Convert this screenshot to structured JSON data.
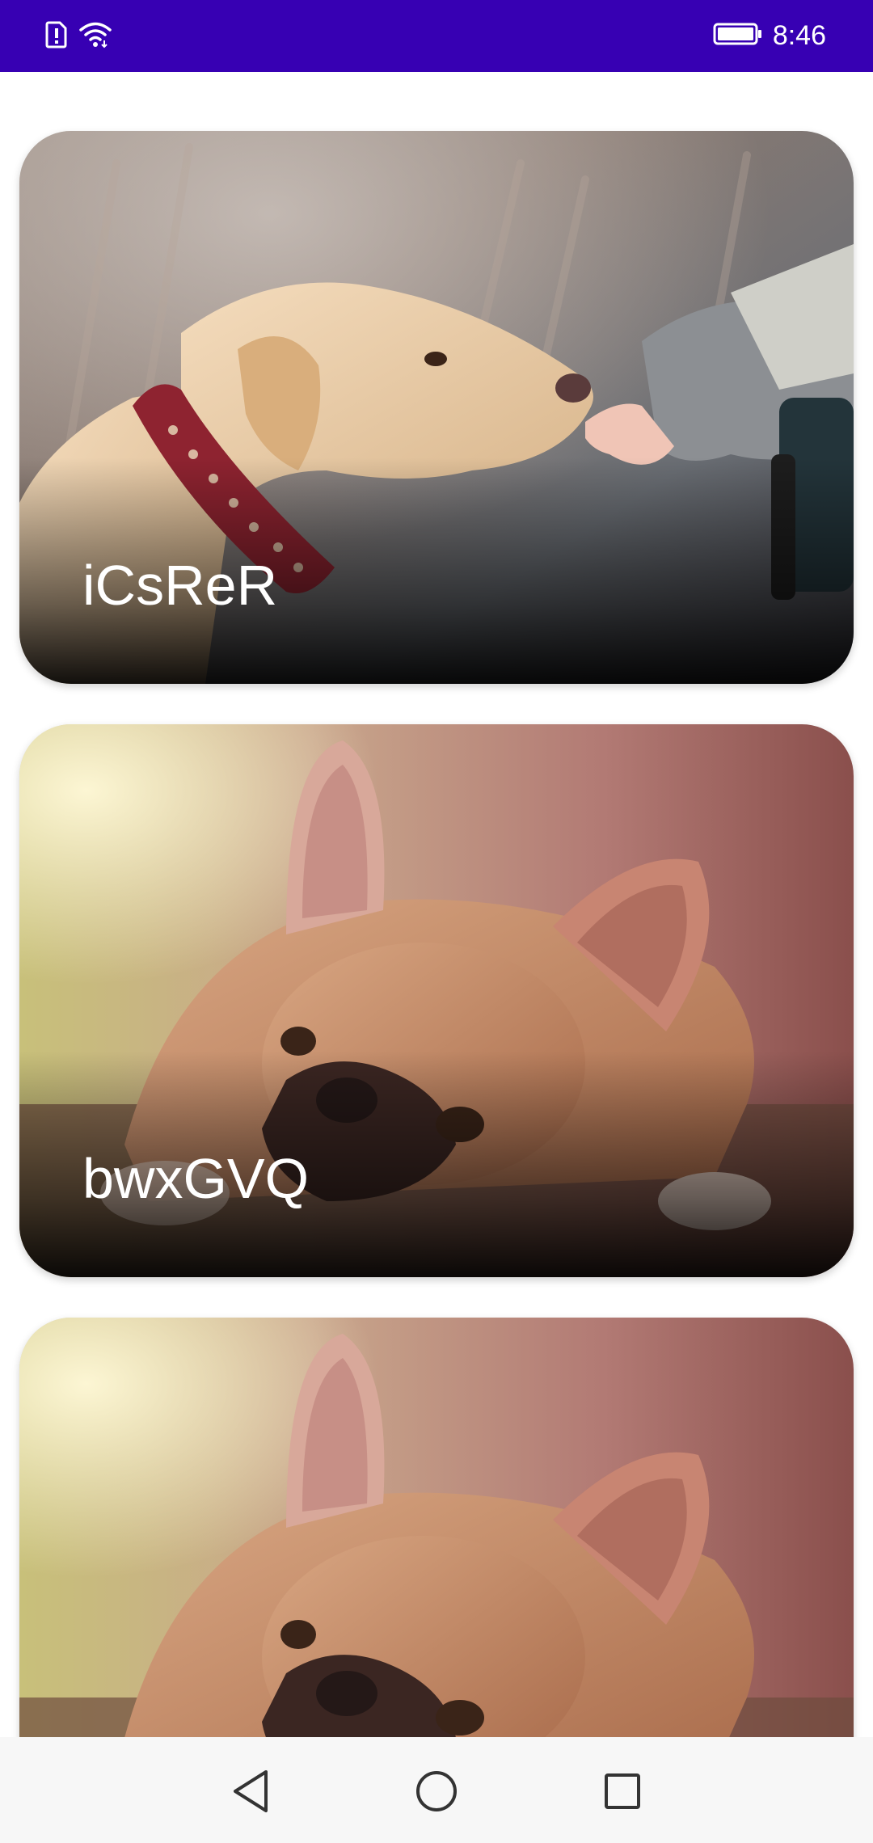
{
  "status_bar": {
    "time": "8:46",
    "icons": [
      "sim-alert-icon",
      "wifi-icon",
      "battery-icon"
    ]
  },
  "cards": [
    {
      "title": "iCsReR",
      "image": "labrador-sniffing-child-hand-photo"
    },
    {
      "title": "bwxGVQ",
      "image": "french-bulldog-lying-photo"
    },
    {
      "title": "",
      "image": "french-bulldog-lying-photo"
    }
  ],
  "nav_bar": {
    "icons": [
      "back-triangle-icon",
      "home-circle-icon",
      "recents-square-icon"
    ]
  },
  "colors": {
    "status_bar": "#3700b3",
    "card_text": "#ffffff",
    "nav_bar": "#f7f7f7",
    "nav_icon": "#333333"
  }
}
